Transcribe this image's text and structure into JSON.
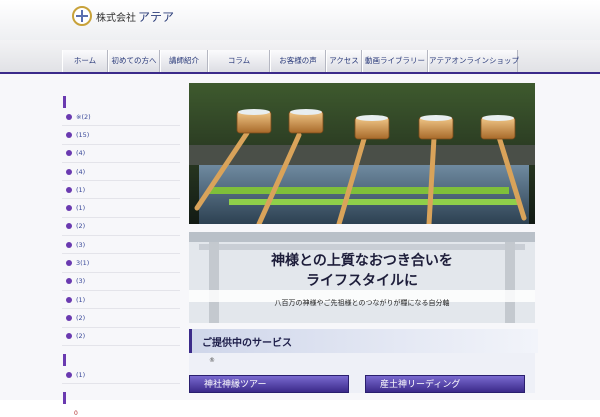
{
  "header": {
    "logo_prefix": "株式会社",
    "logo_name": "アテア"
  },
  "nav": {
    "items": [
      "ホーム",
      "初めての方へ",
      "講師紹介",
      "コラム",
      "お客様の声",
      "アクセス",
      "動画ライブラリー",
      "アテアオンラインショップ"
    ]
  },
  "sidebar": {
    "items": [
      "※(2)",
      "(15)",
      "(4)",
      "(4)",
      "(1)",
      "(1)",
      "(2)",
      "(3)",
      "3(1)",
      "(3)",
      "(1)",
      "(2)",
      "(2)"
    ],
    "items2": [
      "(1)"
    ],
    "tail": "0"
  },
  "hero": {
    "headline1": "神様との上質なおつき合いを",
    "headline2": "ライフスタイルに",
    "subline": "八百万の神様やご先祖様とのつながりが糧になる自分軸"
  },
  "services": {
    "title": "ご提供中のサービス",
    "mark": "®",
    "buttons": [
      "神社神縁ツアー",
      "産土神リーディング"
    ]
  },
  "colors": {
    "accent": "#3b2a8a",
    "bullet": "#6a3ab0",
    "nav_text": "#2a3a7a"
  }
}
